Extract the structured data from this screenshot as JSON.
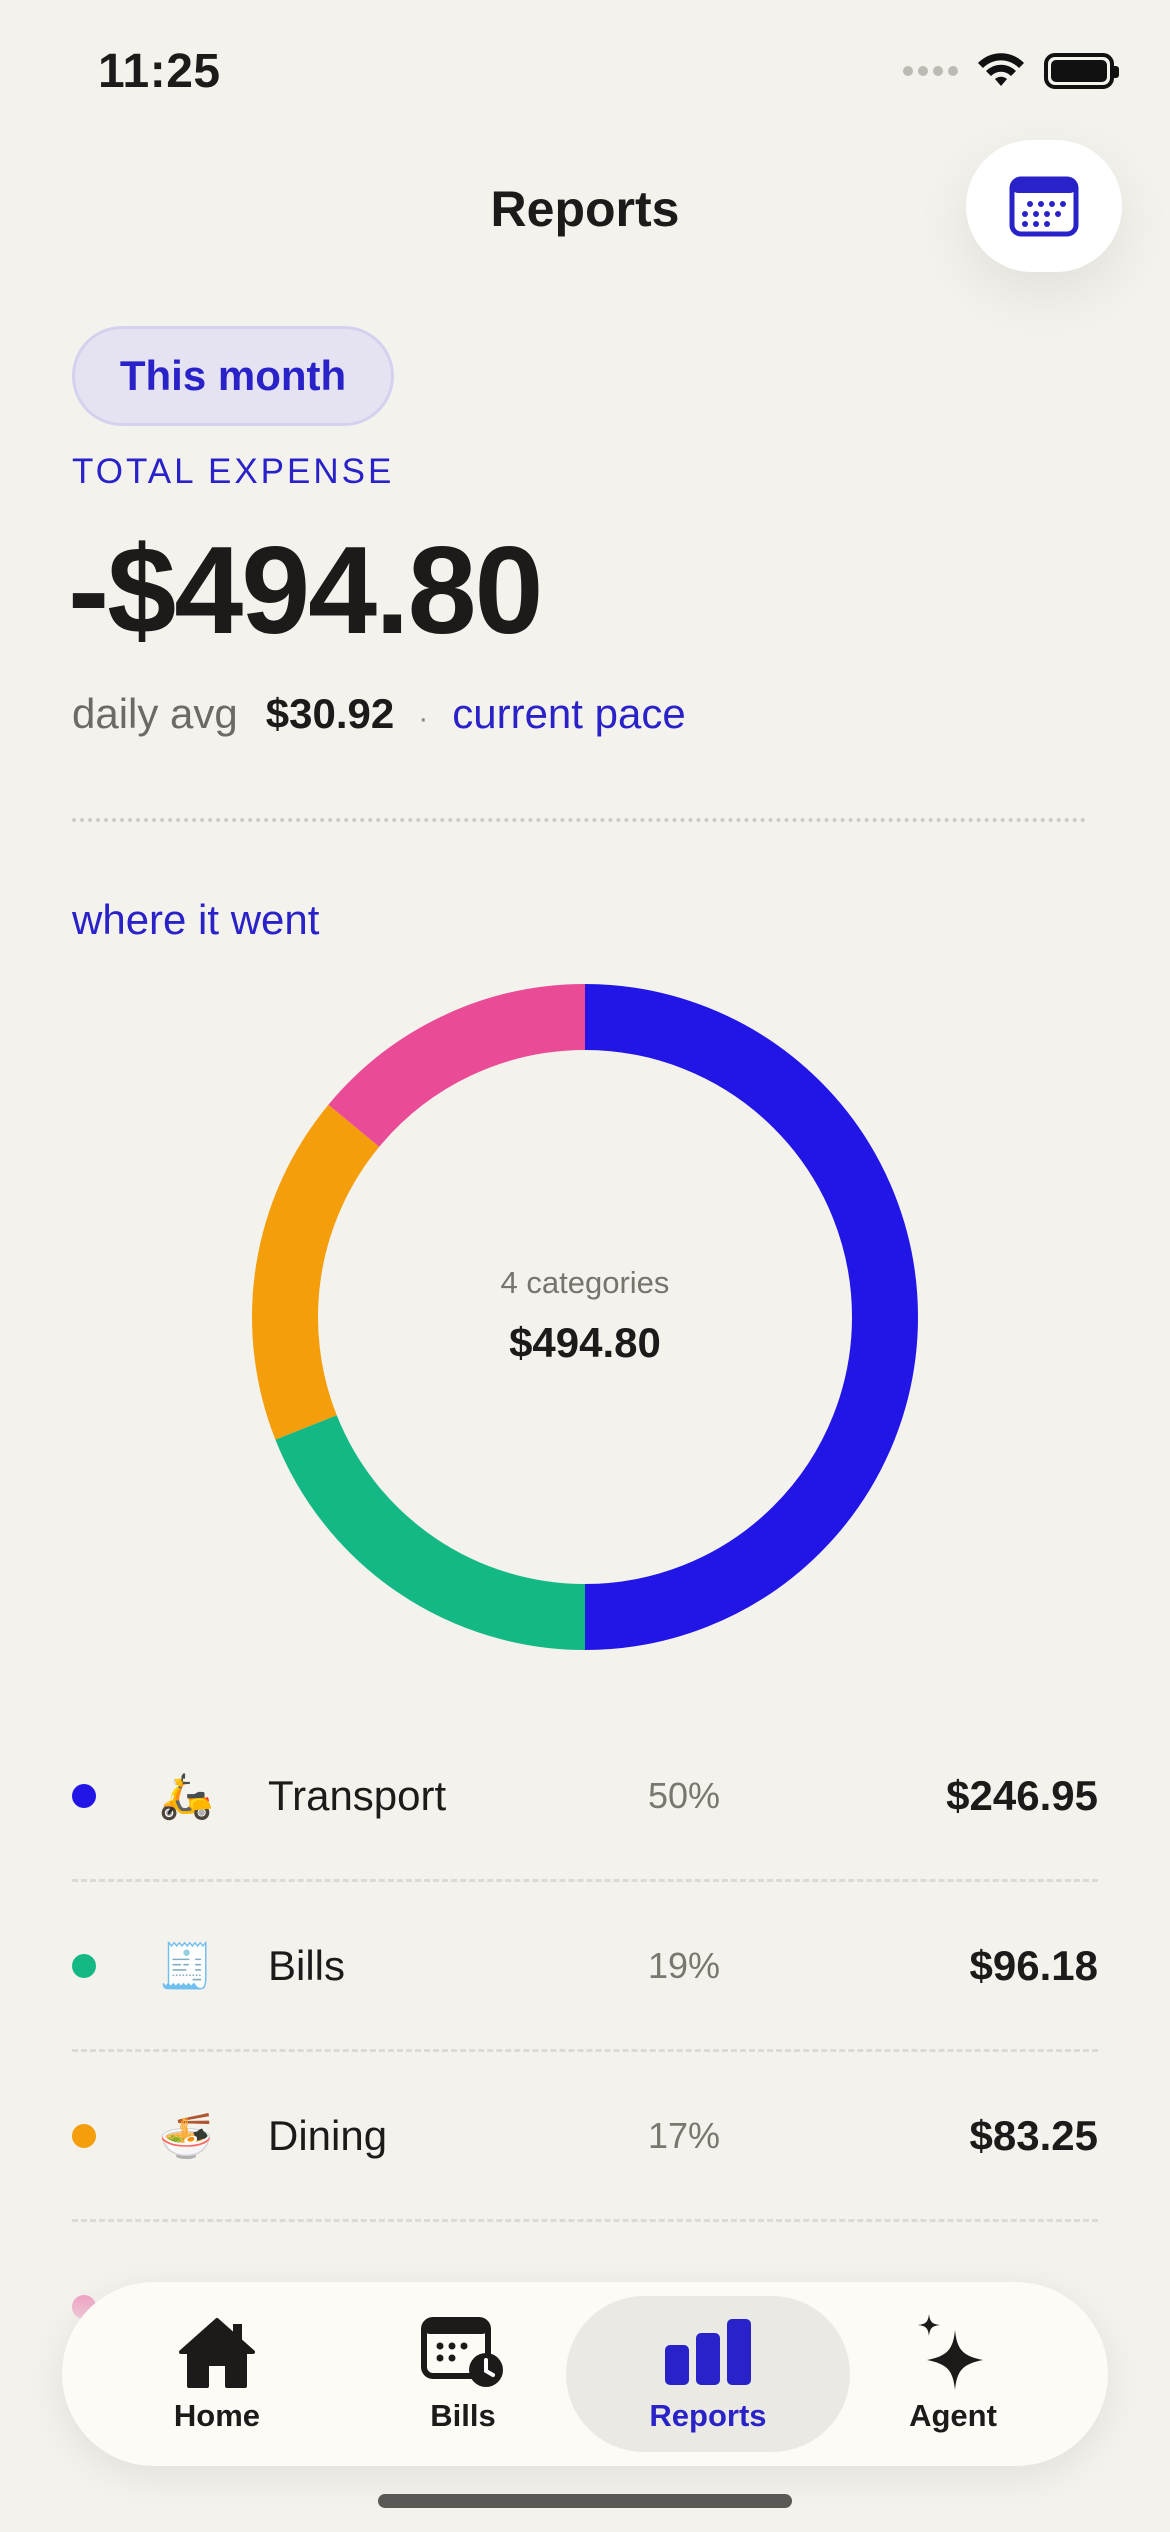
{
  "status_bar": {
    "time": "11:25"
  },
  "header": {
    "title": "Reports",
    "calendar_icon": "calendar-icon"
  },
  "summary": {
    "range_label": "This month",
    "total_label": "TOTAL EXPENSE",
    "total_amount": "-$494.80",
    "daily_avg_label": "daily avg",
    "daily_avg_value": "$30.92",
    "separator": "·",
    "pace_link": "current pace"
  },
  "breakdown": {
    "section_label": "where it went",
    "center_count": "4 categories",
    "center_total": "$494.80"
  },
  "colors": {
    "accent": "#2A22C9",
    "transport": "#2216E6",
    "bills": "#14B885",
    "dining": "#F59E0B",
    "fourth": "#E94B96"
  },
  "categories": [
    {
      "name": "Transport",
      "icon": "scooter-emoji",
      "emoji": "🛵",
      "percent": "50%",
      "amount": "$246.95"
    },
    {
      "name": "Bills",
      "icon": "receipt-emoji",
      "emoji": "🧾",
      "percent": "19%",
      "amount": "$96.18"
    },
    {
      "name": "Dining",
      "icon": "noodles-emoji",
      "emoji": "🍜",
      "percent": "17%",
      "amount": "$83.25"
    }
  ],
  "chart_data": {
    "type": "pie",
    "title": "",
    "categories": [
      "Transport",
      "Bills",
      "Dining",
      ""
    ],
    "values": [
      50,
      19,
      17,
      14
    ],
    "colors": [
      "#2216E6",
      "#14B885",
      "#F59E0B",
      "#E94B96"
    ],
    "center_label": "4 categories",
    "center_value": "$494.80"
  },
  "tabs": [
    {
      "label": "Home",
      "icon": "home-icon",
      "active": false
    },
    {
      "label": "Bills",
      "icon": "bills-calendar-icon",
      "active": false
    },
    {
      "label": "Reports",
      "icon": "bar-chart-icon",
      "active": true
    },
    {
      "label": "Agent",
      "icon": "sparkle-icon",
      "active": false
    }
  ]
}
